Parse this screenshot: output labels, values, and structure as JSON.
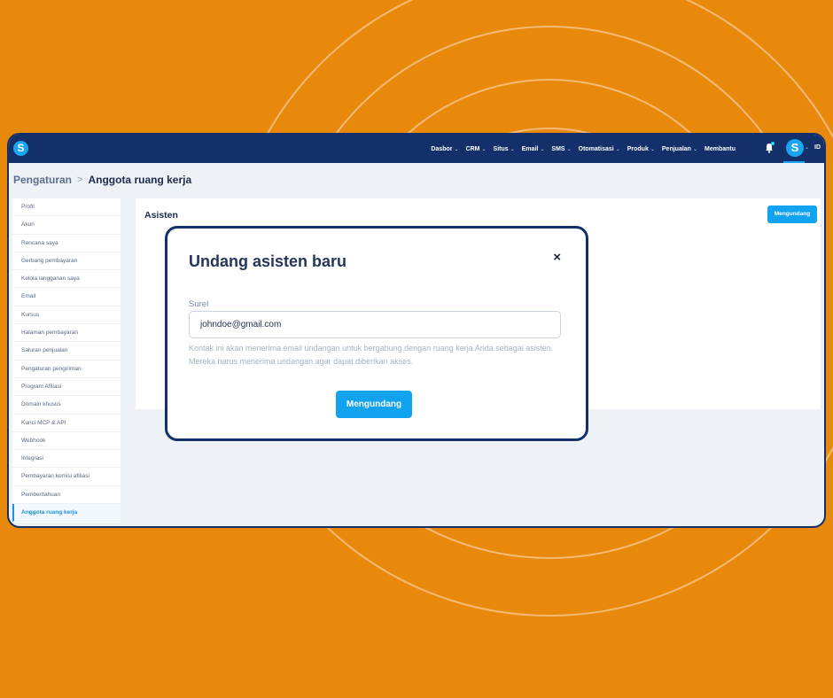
{
  "app": {
    "logo_letter": "S",
    "nav": [
      {
        "label": "Dasbor",
        "has_menu": true
      },
      {
        "label": "CRM",
        "has_menu": true
      },
      {
        "label": "Situs",
        "has_menu": true
      },
      {
        "label": "Email",
        "has_menu": true
      },
      {
        "label": "SMS",
        "has_menu": true
      },
      {
        "label": "Otomatisasi",
        "has_menu": true
      },
      {
        "label": "Produk",
        "has_menu": true
      },
      {
        "label": "Penjualan",
        "has_menu": true
      },
      {
        "label": "Membantu",
        "has_menu": false
      }
    ],
    "avatar_letter": "S",
    "language": "ID"
  },
  "breadcrumb": {
    "parent": "Pengaturan",
    "separator": ">",
    "current": "Anggota ruang kerja"
  },
  "sidebar": {
    "items": [
      "Profil",
      "Akun",
      "Rencana saya",
      "Gerbang pembayaran",
      "Kelola langganan saya",
      "Email",
      "Kursus",
      "Halaman pembayaran",
      "Saluran penjualan",
      "Pengaturan pengiriman",
      "Program Afiliasi",
      "Domain khusus",
      "Kunci MCP & API",
      "Webhook",
      "Integrasi",
      "Pembayaran komisi afiliasi",
      "Pemberitahuan",
      "Anggota ruang kerja"
    ],
    "active_index": 17
  },
  "panel": {
    "title": "Asisten",
    "invite_button": "Mengundang"
  },
  "modal": {
    "title": "Undang asisten baru",
    "close_symbol": "×",
    "field_label": "Surel",
    "email_value": "johndoe@gmail.com",
    "help_text": "Kontak ini akan menerima email undangan untuk bergabung dengan ruang kerja Anda sebagai asisten. Mereka harus menerima undangan agar dapat diberikan akses.",
    "submit_button": "Mengundang"
  },
  "colors": {
    "background": "#e8890c",
    "topbar": "#13306a",
    "accent": "#12a3f0"
  }
}
